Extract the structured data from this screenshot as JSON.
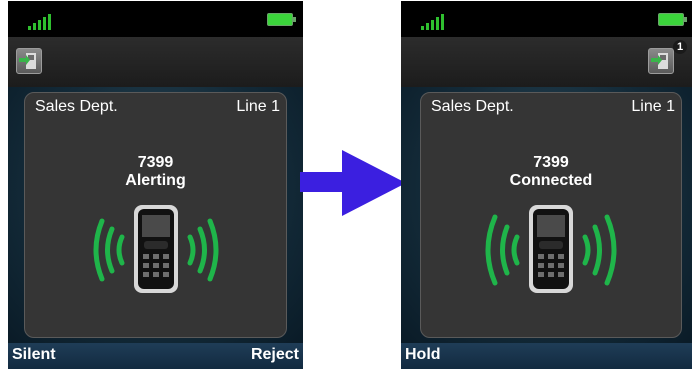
{
  "before": {
    "status": {
      "signal_icon": "signal-strength-icon",
      "battery_icon": "battery-icon"
    },
    "call_icon": "call-icon",
    "call": {
      "name": "Sales Dept.",
      "line": "Line 1",
      "number": "7399",
      "status": "Alerting"
    },
    "softkeys": {
      "left": "Silent",
      "right": "Reject"
    }
  },
  "after": {
    "status": {
      "signal_icon": "signal-strength-icon",
      "battery_icon": "battery-icon"
    },
    "call_icon": "call-icon",
    "call_count": "1",
    "call": {
      "name": "Sales Dept.",
      "line": "Line 1",
      "number": "7399",
      "status": "Connected"
    },
    "softkeys": {
      "left": "Hold"
    }
  },
  "colors": {
    "ring_waves": "#1fb54a",
    "arrow": "#3b1fe0",
    "softkey_bar": "#1f3d57",
    "card": "#353535"
  }
}
